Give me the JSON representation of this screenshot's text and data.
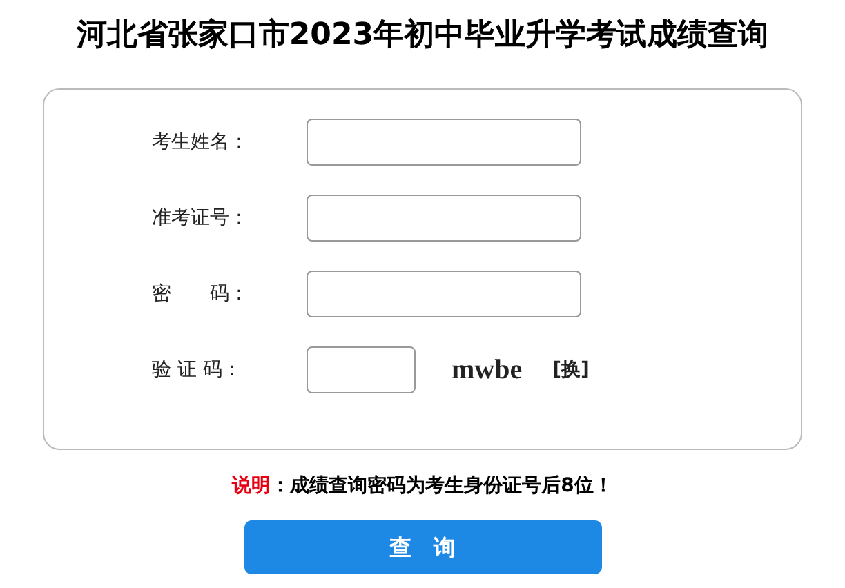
{
  "title": "河北省张家口市2023年初中毕业升学考试成绩查询",
  "fields": [
    {
      "kind": "text",
      "label": "考生姓名："
    },
    {
      "kind": "text",
      "label": "准考证号："
    },
    {
      "kind": "text",
      "label": "密　　码："
    },
    {
      "kind": "captcha",
      "label": "验 证 码：",
      "code": "mwbe",
      "refresh": "[换]"
    }
  ],
  "note": {
    "label": "说明",
    "text": "：成绩查询密码为考生身份证号后8位！"
  },
  "button": "查　询"
}
